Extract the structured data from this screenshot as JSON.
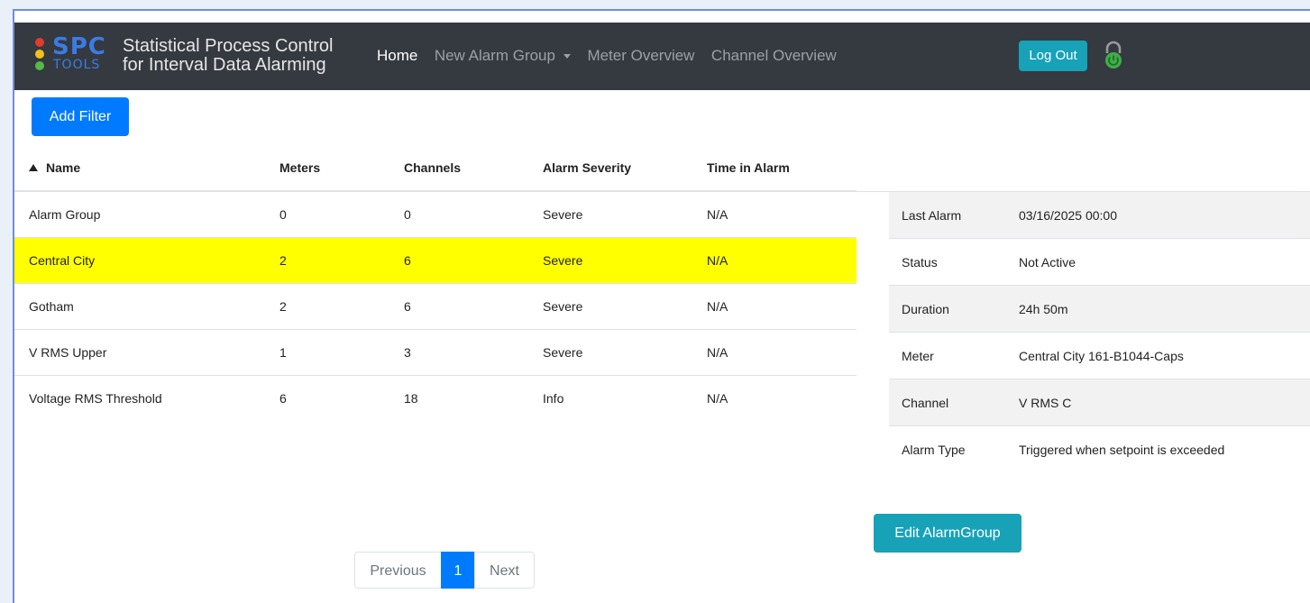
{
  "navbar": {
    "logo_main": "SPC",
    "logo_sub": "TOOLS",
    "logo_title_line1": "Statistical Process Control",
    "logo_title_line2": "for Interval Data Alarming",
    "links": [
      "Home",
      "New Alarm Group",
      "Meter Overview",
      "Channel Overview"
    ],
    "logout_label": "Log Out"
  },
  "toolbar": {
    "add_filter_label": "Add Filter"
  },
  "table": {
    "headers": [
      "Name",
      "Meters",
      "Channels",
      "Alarm Severity",
      "Time in Alarm"
    ],
    "rows": [
      [
        "Alarm Group",
        "0",
        "0",
        "Severe",
        "N/A"
      ],
      [
        "Central City",
        "2",
        "6",
        "Severe",
        "N/A"
      ],
      [
        "Gotham",
        "2",
        "6",
        "Severe",
        "N/A"
      ],
      [
        "V RMS Upper",
        "1",
        "3",
        "Severe",
        "N/A"
      ],
      [
        "Voltage RMS Threshold",
        "6",
        "18",
        "Info",
        "N/A"
      ]
    ],
    "highlight_color": "#ffff00"
  },
  "details": {
    "rows": [
      [
        "Last Alarm",
        "03/16/2025 00:00"
      ],
      [
        "Status",
        "Not Active"
      ],
      [
        "Duration",
        "24h 50m"
      ],
      [
        "Meter",
        "Central City 161-B1044-Caps"
      ],
      [
        "Channel",
        "V RMS C"
      ],
      [
        "Alarm Type",
        "Triggered when setpoint is exceeded"
      ]
    ],
    "edit_label": "Edit AlarmGroup"
  },
  "pagination": {
    "prev_label": "Previous",
    "current_page": "1",
    "next_label": "Next"
  },
  "colors": {
    "navbar": "#343a40",
    "primary": "#007bff",
    "info": "#17a2b8"
  },
  "icons": {
    "sort": "sort-ascending-icon",
    "power": "power-icon",
    "logo": "traffic-light-icon"
  }
}
